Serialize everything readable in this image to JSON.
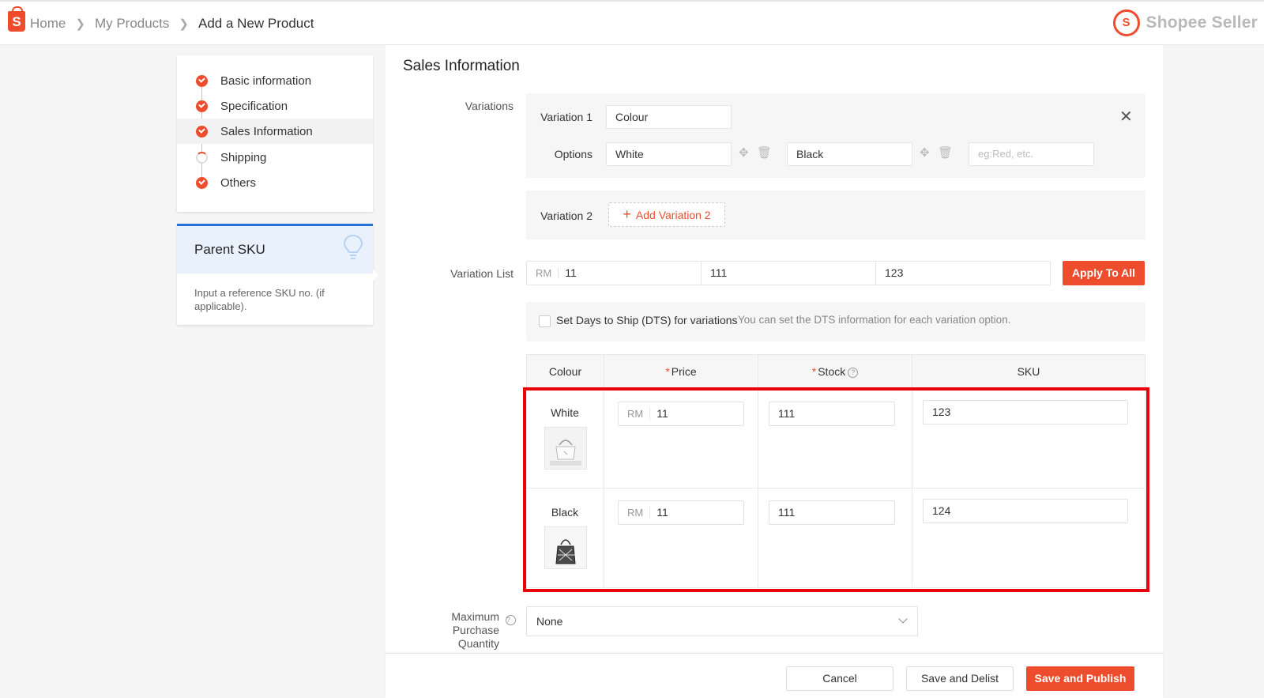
{
  "breadcrumb": {
    "home": "Home",
    "products": "My Products",
    "current": "Add a New Product"
  },
  "brand": {
    "icon_letter": "S",
    "text": "Shopee Seller"
  },
  "logo_letter": "S",
  "steps": [
    {
      "label": "Basic information",
      "status": "done"
    },
    {
      "label": "Specification",
      "status": "done"
    },
    {
      "label": "Sales Information",
      "status": "done"
    },
    {
      "label": "Shipping",
      "status": "partial"
    },
    {
      "label": "Others",
      "status": "done"
    }
  ],
  "parent_sku": {
    "title": "Parent SKU",
    "description": "Input a reference SKU no. (if applicable)."
  },
  "sales": {
    "title": "Sales Information",
    "variations_label": "Variations",
    "variation1": {
      "label": "Variation 1",
      "name_value": "Colour",
      "options_label": "Options",
      "options": [
        "White",
        "Black"
      ],
      "new_option_placeholder": "eg:Red, etc."
    },
    "variation2": {
      "label": "Variation 2",
      "add_button": "Add Variation 2"
    },
    "variation_list": {
      "label": "Variation List",
      "currency": "RM",
      "price": "11",
      "stock": "111",
      "sku": "123",
      "apply_button": "Apply To All"
    },
    "dts": {
      "label": "Set Days to Ship (DTS) for variations",
      "hint": "You can set the DTS information for each variation option."
    },
    "table": {
      "headers": {
        "colour": "Colour",
        "price": "Price",
        "stock": "Stock",
        "sku": "SKU"
      },
      "required_mark": "*",
      "rows": [
        {
          "name": "White",
          "currency": "RM",
          "price": "11",
          "stock": "111",
          "sku": "123"
        },
        {
          "name": "Black",
          "currency": "RM",
          "price": "11",
          "stock": "111",
          "sku": "124"
        }
      ]
    },
    "max_purchase": {
      "label_line1": "Maximum",
      "label_line2": "Purchase Quantity",
      "value": "None"
    }
  },
  "footer": {
    "cancel": "Cancel",
    "save_delist": "Save and Delist",
    "save_publish": "Save and Publish"
  },
  "colors": {
    "accent": "#ee4d2d",
    "highlight": "#e8000b",
    "info": "#2673dd"
  }
}
